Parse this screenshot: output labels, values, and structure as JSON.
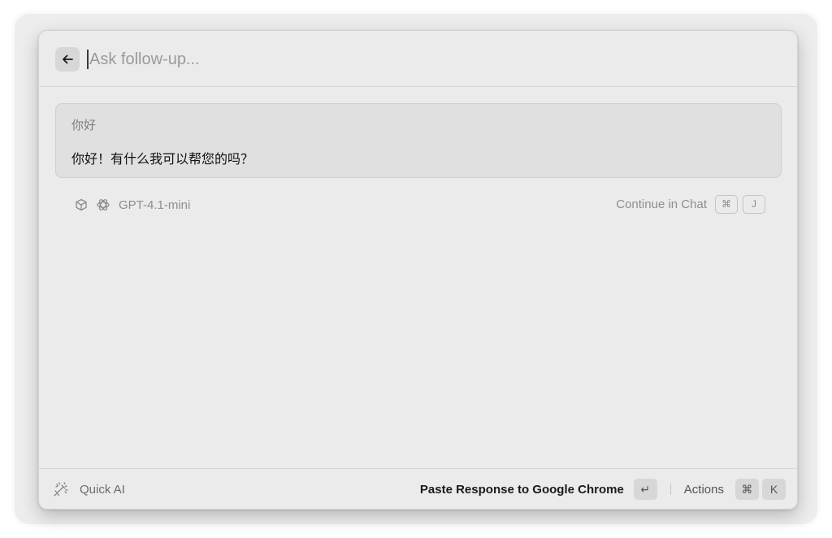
{
  "header": {
    "search_placeholder": "Ask follow-up...",
    "back_icon": "arrow-left-icon"
  },
  "conversation": {
    "question": "你好",
    "answer": "你好！有什么我可以帮您的吗？"
  },
  "meta": {
    "cube_icon": "cube-icon",
    "model_icon": "openai-icon",
    "model_name": "GPT-4.1-mini",
    "continue_label": "Continue in Chat",
    "continue_key1": "⌘",
    "continue_key2": "J"
  },
  "footer": {
    "app_icon": "quick-ai-icon",
    "app_name": "Quick AI",
    "primary_action": "Paste Response to Google Chrome",
    "primary_key": "↵",
    "actions_label": "Actions",
    "actions_key1": "⌘",
    "actions_key2": "K"
  }
}
